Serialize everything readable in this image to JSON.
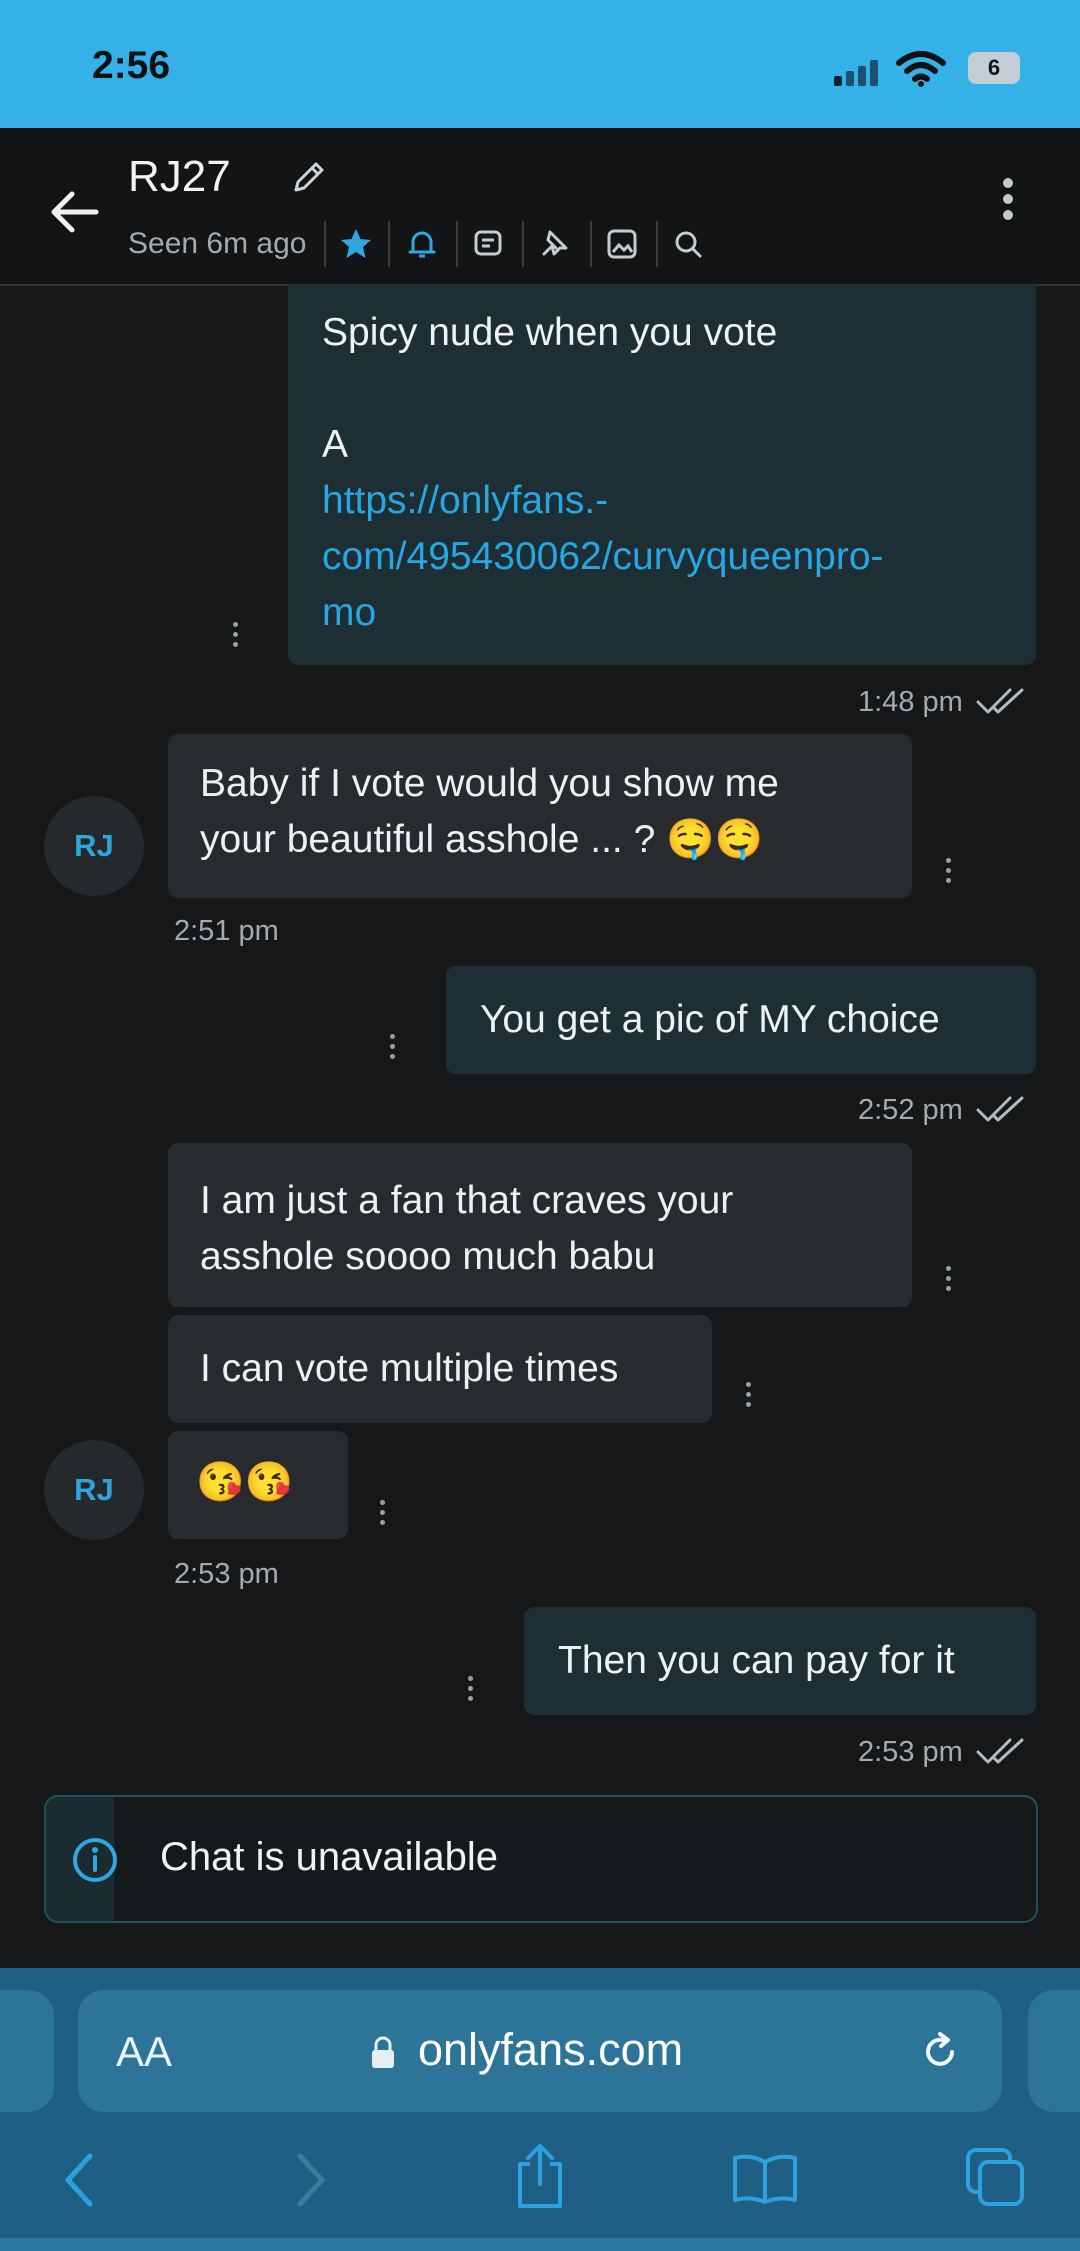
{
  "status_bar": {
    "time": "2:56",
    "battery": "6"
  },
  "header": {
    "contact_name": "RJ27",
    "seen": "Seen 6m ago"
  },
  "messages": [
    {
      "direction": "out",
      "lines": [
        "Spicy nude when you vote",
        "",
        "A"
      ],
      "link": [
        "https://onlyfans.-",
        "com/495430062/curvyqueenpro-",
        "mo"
      ],
      "time": "1:48 pm"
    },
    {
      "direction": "in",
      "text_line1": "Baby if I vote would you show me",
      "text_line2": "your beautiful asshole ... ?",
      "emoji": "🤤🤤",
      "time": "2:51 pm"
    },
    {
      "direction": "out",
      "text": "You get a pic of MY choice",
      "time": "2:52 pm"
    },
    {
      "direction": "in",
      "text_line1": "I am just a fan that craves your",
      "text_line2": "asshole soooo much babu"
    },
    {
      "direction": "in",
      "text": "I can vote multiple times"
    },
    {
      "direction": "in",
      "emoji": "😘😘",
      "time": "2:53 pm"
    },
    {
      "direction": "out",
      "text": "Then you can pay for it",
      "time": "2:53 pm"
    }
  ],
  "avatar_initials": "RJ",
  "chat_status": "Chat is unavailable",
  "browser": {
    "text_size_label": "AA",
    "domain": "onlyfans.com"
  },
  "colors": {
    "accent": "#34b1e6",
    "link": "#28a6e2",
    "background": "#161718"
  }
}
